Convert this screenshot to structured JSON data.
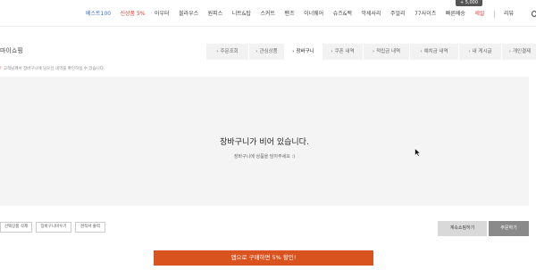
{
  "nav": {
    "items": [
      {
        "label": "베스트100",
        "tone": "blue"
      },
      {
        "label": "신상품 5%",
        "tone": "red"
      },
      {
        "label": "아우터",
        "tone": ""
      },
      {
        "label": "블라우스",
        "tone": ""
      },
      {
        "label": "원피스",
        "tone": ""
      },
      {
        "label": "니트&탑",
        "tone": ""
      },
      {
        "label": "스커트",
        "tone": ""
      },
      {
        "label": "팬츠",
        "tone": ""
      },
      {
        "label": "이너웨어",
        "tone": ""
      },
      {
        "label": "슈즈&백",
        "tone": ""
      },
      {
        "label": "악세사리",
        "tone": ""
      },
      {
        "label": "주얼리",
        "tone": ""
      },
      {
        "label": "77사이즈",
        "tone": ""
      },
      {
        "label": "빠른배송",
        "tone": ""
      },
      {
        "label": "세일",
        "tone": "red"
      }
    ],
    "review_label": "리뷰",
    "badge": "+ 5,000"
  },
  "page": {
    "title": "마이쇼핑",
    "notice_mark": "!",
    "notice": "고객님께서 장바구니에 담으신 내역을 확인하실 수 있습니다."
  },
  "tabs": [
    {
      "label": "주문조회",
      "active": false
    },
    {
      "label": "관심상품",
      "active": false
    },
    {
      "label": "장바구니",
      "active": true
    },
    {
      "label": "쿠폰 내역",
      "active": false
    },
    {
      "label": "적립금 내역",
      "active": false
    },
    {
      "label": "예치금 내역",
      "active": false
    },
    {
      "label": "내 게시글",
      "active": false
    },
    {
      "label": "개인결제",
      "active": false
    }
  ],
  "cart": {
    "empty_title": "장바구니가 비어 있습니다.",
    "empty_sub": "장바구니에 상품을 담아주세요 :)"
  },
  "actions": {
    "delete_selected": "선택상품 삭제",
    "empty_cart": "장바구니비우기",
    "estimate": "견적서 출력",
    "continue_shopping": "계속쇼핑하기",
    "order": "주문하기"
  },
  "banner": {
    "label": "앱으로 구매하면 5% 할인!"
  },
  "colors": {
    "accent_blue": "#3a6fd8",
    "accent_red": "#e0372f",
    "banner_orange": "#d9531f"
  }
}
